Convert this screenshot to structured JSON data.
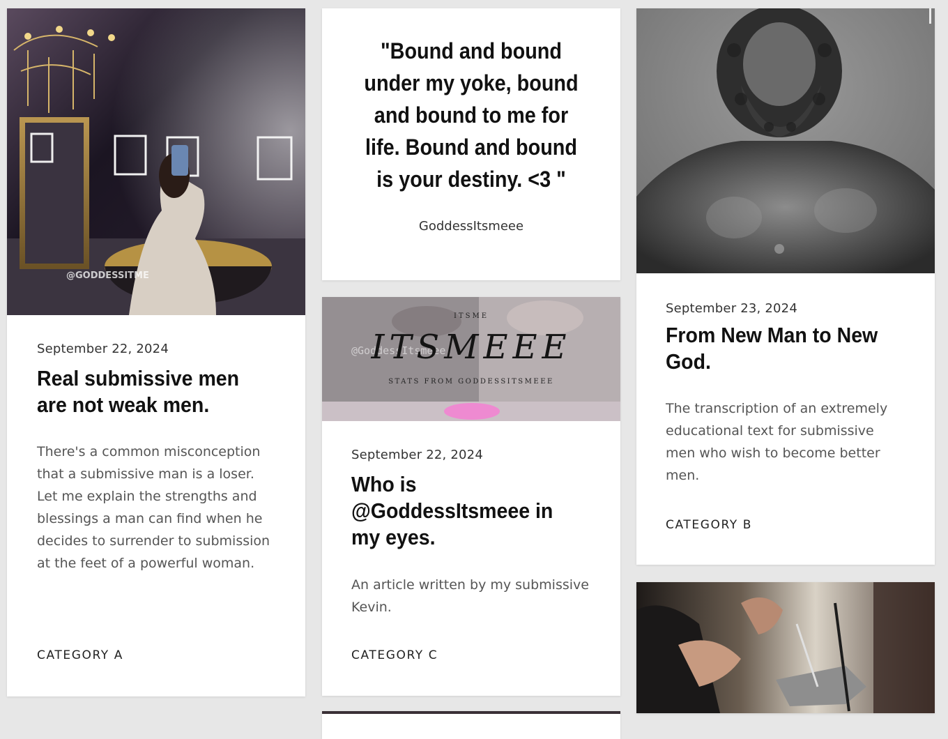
{
  "cards": [
    {
      "date": "September 22, 2024",
      "title": "Real submissive men are not weak men.",
      "excerpt": "There's a common misconception that a submissive man is a loser. Let me explain the strengths and blessings a man can find when he decides to surrender to submission at the feet of a powerful woman.",
      "category": "CATEGORY A",
      "image_watermark": "@GODDESSITME",
      "image_icon": "woman-selfie-bathroom-image"
    },
    {
      "quote": "\"Bound and bound under my yoke, bound and bound to me for life. Bound and bound is your destiny. <3 \"",
      "author": "GoddessItsmeee"
    },
    {
      "date": "September 22, 2024",
      "title": "Who is @GoddessItsmeee in my eyes.",
      "excerpt": "An article written by my submissive Kevin.",
      "category": "CATEGORY C",
      "banner": {
        "top": "ITSME",
        "main": "ITSMEEE",
        "overlay": "@GoddessItsmeee",
        "sub": "STATS FROM GODDESSITSMEEE"
      }
    },
    {
      "date": "September 23, 2024",
      "title": "From New Man to New God.",
      "excerpt": "The transcription of an extremely educational text for submissive men who wish to become better men.",
      "category": "CATEGORY B",
      "image_icon": "bronze-statue-image"
    },
    {
      "image_icon": "heels-kneeling-man-image"
    }
  ],
  "colors": {
    "page_bg": "#e7e7e7",
    "card_bg": "#ffffff",
    "title": "#111111",
    "excerpt": "#555555"
  }
}
